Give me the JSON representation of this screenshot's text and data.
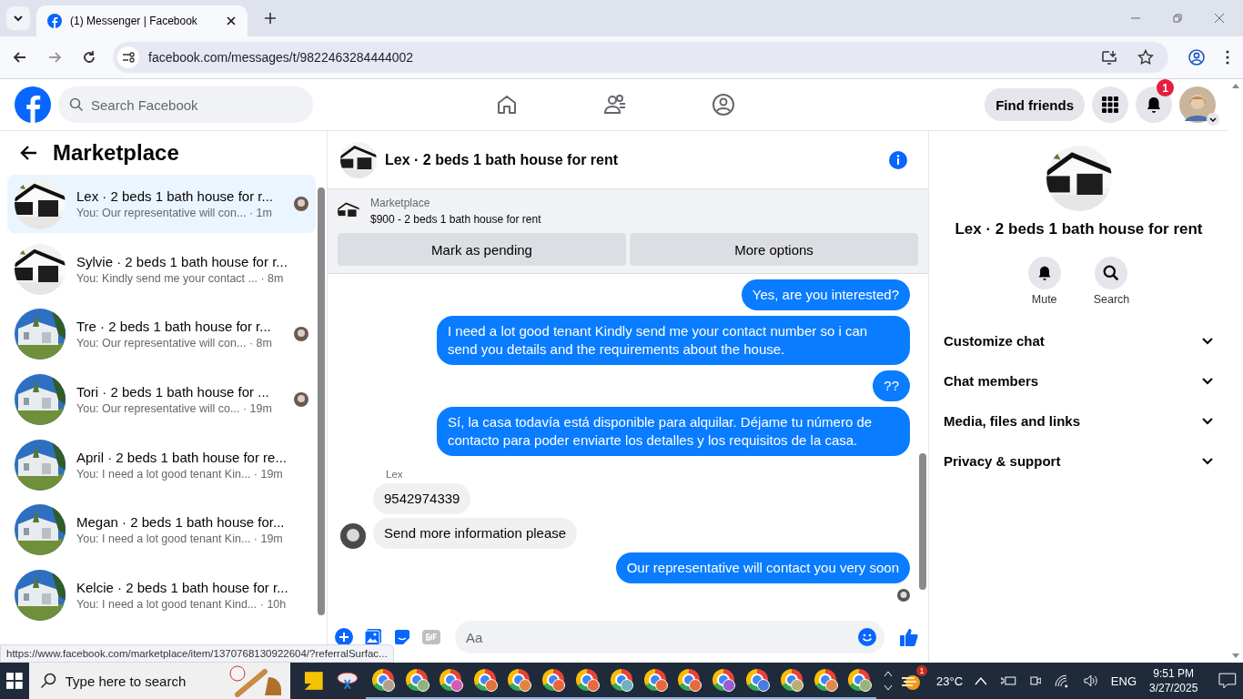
{
  "browser": {
    "tab_title": "(1) Messenger | Facebook",
    "url": "facebook.com/messages/t/9822463284444002"
  },
  "header": {
    "search_placeholder": "Search Facebook",
    "find_friends": "Find friends",
    "notification_count": "1"
  },
  "sidebar": {
    "title": "Marketplace",
    "conversations": [
      {
        "title": "Lex · 2 beds 1 bath house for r...",
        "preview": "You: Our representative will con... · 1m",
        "selected": true,
        "seen_avatar": true
      },
      {
        "title": "Sylvie · 2 beds 1 bath house for r...",
        "preview": "You: Kindly send me your contact ...  · 8m",
        "selected": false,
        "seen_avatar": false
      },
      {
        "title": "Tre · 2 beds 1 bath house for r...",
        "preview": "You: Our representative will con... · 8m",
        "selected": false,
        "seen_avatar": true
      },
      {
        "title": "Tori · 2 beds 1 bath house for ...",
        "preview": "You: Our representative will co... · 19m",
        "selected": false,
        "seen_avatar": true
      },
      {
        "title": "April · 2 beds 1 bath house for re...",
        "preview": "You: I need a lot good tenant Kin...  · 19m",
        "selected": false,
        "seen_avatar": false
      },
      {
        "title": "Megan · 2 beds 1 bath house for...",
        "preview": "You: I need a lot good tenant Kin...  · 19m",
        "selected": false,
        "seen_avatar": false
      },
      {
        "title": "Kelcie · 2 beds 1 bath house for r...",
        "preview": "You: I need a lot good tenant Kind... · 10h",
        "selected": false,
        "seen_avatar": false
      }
    ]
  },
  "chat": {
    "title": "Lex · 2 beds 1 bath house for rent",
    "listing": {
      "source": "Marketplace",
      "summary": "$900 - 2 beds 1 bath house for rent",
      "buttons": [
        "Mark as pending",
        "More options"
      ]
    },
    "messages": [
      {
        "kind": "outgoing",
        "text": "Yes, are you interested?"
      },
      {
        "kind": "outgoing",
        "text": "I need a lot good tenant Kindly send me your contact number so i can send you details and the requirements about the house."
      },
      {
        "kind": "outgoing",
        "text": "??"
      },
      {
        "kind": "outgoing",
        "text": "Sí, la casa todavía está disponible para alquilar. Déjame tu número de contacto para poder enviarte los detalles y los requisitos de la casa."
      },
      {
        "kind": "sender",
        "text": "Lex"
      },
      {
        "kind": "incoming",
        "text": "9542974339",
        "avatar": false
      },
      {
        "kind": "incoming",
        "text": "Send more information please",
        "avatar": true
      },
      {
        "kind": "outgoing",
        "text": "Our representative will contact you very soon"
      }
    ],
    "composer_placeholder": "Aa"
  },
  "details": {
    "title": "Lex · 2 beds 1 bath house for rent",
    "actions": [
      "Mute",
      "Search"
    ],
    "sections": [
      "Customize chat",
      "Chat members",
      "Media, files and links",
      "Privacy & support"
    ]
  },
  "status_url": "https://www.facebook.com/marketplace/item/1370768130922604/?referralSurfac...",
  "taskbar": {
    "search_placeholder": "Type here to search",
    "apps": [
      {
        "color": "#b0a090"
      },
      {
        "color": "#8fb37a"
      },
      {
        "color": "#d35bb5"
      },
      {
        "color": "#e2733a"
      },
      {
        "color": "#e0853a"
      },
      {
        "color": "#e8683a"
      },
      {
        "color": "#e8683a"
      },
      {
        "color": "#6fb0c0"
      },
      {
        "color": "#e8683a"
      },
      {
        "color": "#e8683a"
      },
      {
        "color": "#9a5bd6"
      },
      {
        "color": "#4a7be0"
      },
      {
        "color": "#b8b070"
      },
      {
        "color": "#e08a4a"
      },
      {
        "color": "#9ab37a"
      }
    ],
    "weather_badge": "1",
    "temperature": "23°C",
    "language": "ENG",
    "time": "9:51 PM",
    "date": "3/27/2025"
  }
}
